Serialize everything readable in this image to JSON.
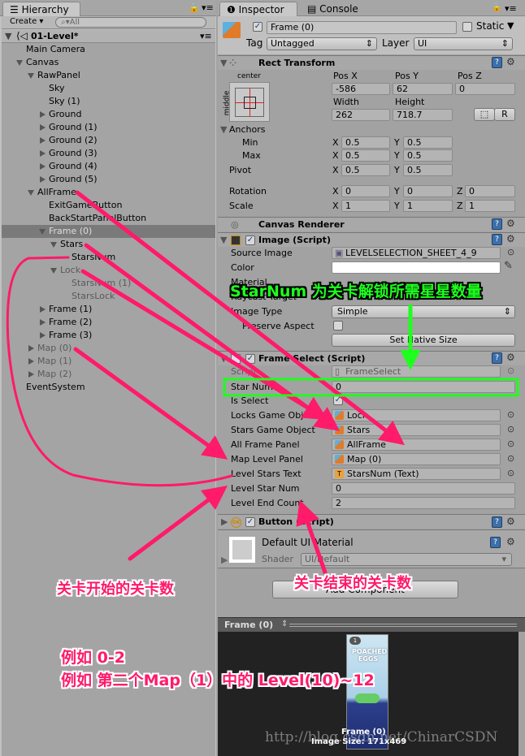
{
  "hierarchy": {
    "tab": "Hierarchy",
    "create": "Create",
    "search_placeholder": "All",
    "scene": "01-Level*",
    "items": [
      {
        "label": "Main Camera"
      },
      {
        "label": "Canvas"
      },
      {
        "label": "RawPanel"
      },
      {
        "label": "Sky"
      },
      {
        "label": "Sky (1)"
      },
      {
        "label": "Ground"
      },
      {
        "label": "Ground (1)"
      },
      {
        "label": "Ground (2)"
      },
      {
        "label": "Ground (3)"
      },
      {
        "label": "Ground (4)"
      },
      {
        "label": "Ground (5)"
      },
      {
        "label": "AllFrame"
      },
      {
        "label": "ExitGameButton"
      },
      {
        "label": "BackStartPanelButton"
      },
      {
        "label": "Frame (0)",
        "selected": true
      },
      {
        "label": "Stars"
      },
      {
        "label": "StarsNum"
      },
      {
        "label": "Lock"
      },
      {
        "label": "StarsNum (1)"
      },
      {
        "label": "StarsLock"
      },
      {
        "label": "Frame (1)"
      },
      {
        "label": "Frame (2)"
      },
      {
        "label": "Frame (3)"
      },
      {
        "label": "Map (0)"
      },
      {
        "label": "Map (1)"
      },
      {
        "label": "Map (2)"
      },
      {
        "label": "EventSystem"
      }
    ]
  },
  "inspector": {
    "tabs": [
      "Inspector",
      "Console"
    ],
    "object_name": "Frame (0)",
    "static_label": "Static",
    "tag_label": "Tag",
    "tag_value": "Untagged",
    "layer_label": "Layer",
    "layer_value": "UI",
    "rect_transform": {
      "title": "Rect Transform",
      "anchor_h": "center",
      "anchor_v": "middle",
      "pos_x_label": "Pos X",
      "pos_y_label": "Pos Y",
      "pos_z_label": "Pos Z",
      "pos_x": "-586",
      "pos_y": "62",
      "pos_z": "0",
      "width_label": "Width",
      "height_label": "Height",
      "width": "262",
      "height": "718.7",
      "r_button": "R",
      "anchors": "Anchors",
      "min": "Min",
      "max": "Max",
      "pivot": "Pivot",
      "rotation": "Rotation",
      "scale": "Scale",
      "x": "X",
      "y": "Y",
      "z": "Z",
      "min_x": "0.5",
      "min_y": "0.5",
      "max_x": "0.5",
      "max_y": "0.5",
      "pivot_x": "0.5",
      "pivot_y": "0.5",
      "rot_x": "0",
      "rot_y": "0",
      "rot_z": "0",
      "scale_x": "1",
      "scale_y": "1",
      "scale_z": "1"
    },
    "canvas_renderer": {
      "title": "Canvas Renderer"
    },
    "image": {
      "title": "Image (Script)",
      "source_image_label": "Source Image",
      "source_image": "LEVELSELECTION_SHEET_4_9",
      "color_label": "Color",
      "material_label": "Material",
      "raycast_label": "Raycast Target",
      "image_type_label": "Image Type",
      "image_type": "Simple",
      "preserve_label": "Preserve Aspect",
      "native_size": "Set Native Size"
    },
    "frame_select": {
      "title": "Frame Select (Script)",
      "script_label": "Script",
      "script": "FrameSelect",
      "star_num_label": "Star Num",
      "star_num": "0",
      "is_select_label": "Is Select",
      "locks_label": "Locks Game Object",
      "locks": "Lock",
      "stars_label": "Stars Game Object",
      "stars": "Stars",
      "all_frame_label": "All Frame Panel",
      "all_frame": "AllFrame",
      "map_label": "Map Level Panel",
      "map": "Map (0)",
      "level_stars_text_label": "Level Stars Text",
      "level_stars_text": "StarsNum (Text)",
      "level_star_num_label": "Level Star Num",
      "level_star_num": "0",
      "level_end_label": "Level End Count",
      "level_end": "2"
    },
    "button": {
      "title": "Button (Script)"
    },
    "material": {
      "name": "Default UI Material",
      "shader_label": "Shader",
      "shader": "UI/Default"
    },
    "add_component": "Add Component",
    "preview": {
      "title": "Frame (0)",
      "caption": "Frame (0)",
      "size": "Image Size: 171x469",
      "art_text": "POACHED EGGS",
      "art_num": "1"
    }
  },
  "annotations": {
    "star_num_note": "StarNum 为关卡解锁所需星星数量",
    "start_note": "关卡开始的关卡数",
    "end_note": "关卡结束的关卡数",
    "example1": "例如 0-2",
    "example2": "例如 第二个Map（1）中的 Level(10)~12",
    "watermark": "http://blog.csdn.net/ChinarCSDN",
    "pink": "#ff1a6a",
    "green": "#1eff1e"
  }
}
